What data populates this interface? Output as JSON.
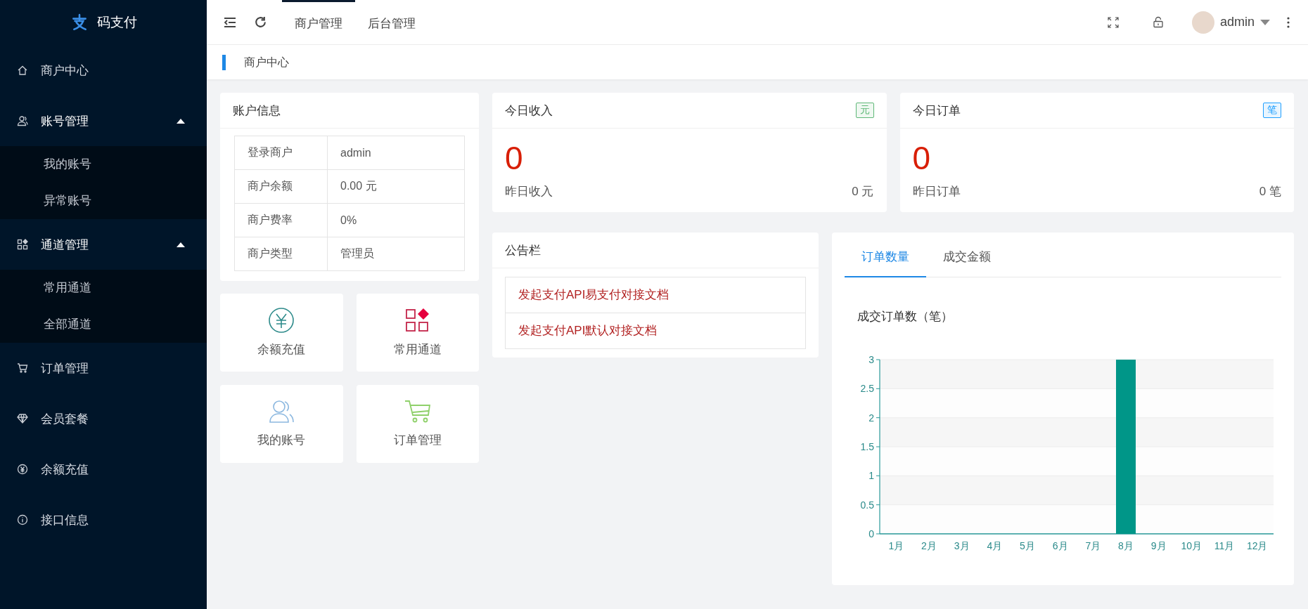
{
  "brand": {
    "name": "码支付"
  },
  "sidebar": {
    "items": [
      {
        "label": "商户中心"
      },
      {
        "label": "账号管理",
        "expanded": true,
        "children": [
          {
            "label": "我的账号"
          },
          {
            "label": "异常账号"
          }
        ]
      },
      {
        "label": "通道管理",
        "expanded": true,
        "children": [
          {
            "label": "常用通道"
          },
          {
            "label": "全部通道"
          }
        ]
      },
      {
        "label": "订单管理"
      },
      {
        "label": "会员套餐"
      },
      {
        "label": "余额充值"
      },
      {
        "label": "接口信息"
      }
    ]
  },
  "header": {
    "tabs": [
      {
        "label": "商户管理",
        "selected": true
      },
      {
        "label": "后台管理",
        "selected": false
      }
    ],
    "user": "admin"
  },
  "breadcrumb": "商户中心",
  "account_info": {
    "title": "账户信息",
    "rows": [
      {
        "label": "登录商户",
        "value": "admin"
      },
      {
        "label": "商户余额",
        "value": "0.00 元"
      },
      {
        "label": "商户费率",
        "value": "0%"
      },
      {
        "label": "商户类型",
        "value": "管理员"
      }
    ]
  },
  "quick_links": [
    {
      "label": "余额充值"
    },
    {
      "label": "常用通道"
    },
    {
      "label": "我的账号"
    },
    {
      "label": "订单管理"
    }
  ],
  "stats": [
    {
      "title": "今日收入",
      "badge": "元",
      "color": "#5fb878",
      "value": "0",
      "sub_label": "昨日收入",
      "sub_value": "0 元"
    },
    {
      "title": "今日订单",
      "badge": "笔",
      "color": "#1e9fff",
      "value": "0",
      "sub_label": "昨日订单",
      "sub_value": "0 笔"
    }
  ],
  "notice": {
    "title": "公告栏",
    "links": [
      "发起支付API易支付对接文档",
      "发起支付API默认对接文档"
    ]
  },
  "chart_panel": {
    "tabs": [
      {
        "label": "订单数量",
        "selected": true
      },
      {
        "label": "成交金额",
        "selected": false
      }
    ],
    "chart_data": {
      "type": "bar",
      "title": "成交订单数（笔）",
      "categories": [
        "1月",
        "2月",
        "3月",
        "4月",
        "5月",
        "6月",
        "7月",
        "8月",
        "9月",
        "10月",
        "11月",
        "12月"
      ],
      "series": [
        {
          "color": "#009688",
          "values": [
            0,
            0,
            0,
            0,
            0,
            0,
            0,
            3,
            0,
            0,
            0,
            0
          ]
        }
      ],
      "grid": true,
      "ylim": [
        0,
        3
      ],
      "yticks": [
        0,
        0.5,
        1,
        1.5,
        2,
        2.5,
        3
      ]
    }
  }
}
